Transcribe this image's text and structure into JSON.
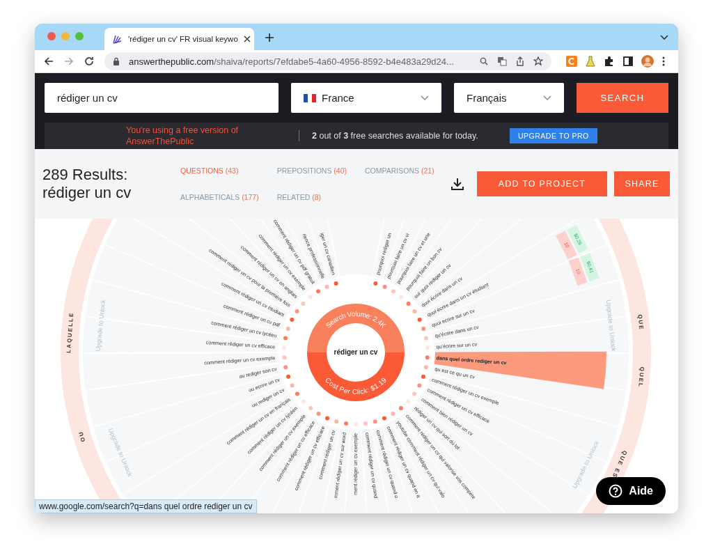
{
  "browser": {
    "tab_title": "'rédiger un cv' FR visual keywo",
    "url_domain": "answerthepublic.com",
    "url_path": "/shaiva/reports/7efdabe5-4a60-4956-8592-b4e483a29d24..."
  },
  "search": {
    "query": "rédiger un cv",
    "country": "France",
    "language": "Français",
    "button": "SEARCH"
  },
  "notice": {
    "message": "You're using a free version of AnswerThePublic",
    "quota": "**2** out of **3** free searches available for today.",
    "upgrade": "UPGRADE TO PRO"
  },
  "results": {
    "count": "289 Results:",
    "term": "rédiger un cv",
    "tabs": [
      {
        "label": "QUESTIONS",
        "count": "(43)",
        "selected": true
      },
      {
        "label": "PREPOSITIONS",
        "count": "(40)",
        "selected": false
      },
      {
        "label": "COMPARISONS",
        "count": "(21)",
        "selected": false
      },
      {
        "label": "ALPHABETICALS",
        "count": "(177)",
        "selected": false
      },
      {
        "label": "RELATED",
        "count": "(8)",
        "selected": false
      }
    ],
    "actions": [
      "ADD TO PROJECT",
      "SHARE"
    ]
  },
  "wheel": {
    "center": "rédiger un cv",
    "search_volume": "Search Volume: 2.4K",
    "cost_per_click": "Cost Per Click: $1.19",
    "groups": [
      "QUE",
      "QUEL",
      "QUE ES",
      "OU",
      "LAQUELLE"
    ],
    "upgrade_notes": [
      "Upgrade to Unlock",
      "Upgrade to Unlock",
      "Upgrade to Unlock",
      "Upgrade to Unlock"
    ],
    "metrics": [
      {
        "volume": "10",
        "cpc": "$0.26"
      },
      {
        "volume": "10",
        "cpc": "$0.41"
      }
    ],
    "keywords": [
      {
        "text": "pourquoi rediger un",
        "selected": false
      },
      {
        "text": "pourquoi faire un cv vi",
        "selected": false
      },
      {
        "text": "pourquoi faire un cv et une",
        "selected": false
      },
      {
        "text": "pourquoi faire un bon cv",
        "selected": false
      },
      {
        "text": "sur quoi rediger un cv",
        "selected": false
      },
      {
        "text": "quoi écrire dans un cv",
        "selected": false
      },
      {
        "text": "quoi écrire dans un cv étudiant",
        "selected": false
      },
      {
        "text": "quoi ecrire sur un cv",
        "selected": false
      },
      {
        "text": "qu'écrire dans un cv",
        "selected": false
      },
      {
        "text": "qu'écrire sur un cv",
        "selected": false
      },
      {
        "text": "dans quel ordre rediger un cv",
        "selected": true
      },
      {
        "text": "qu est ce qu un cv",
        "selected": false
      },
      {
        "text": "comment rédiger un cv exemple",
        "selected": false
      },
      {
        "text": "comment rédiger un cv efficace",
        "selected": false
      },
      {
        "text": "comment bien rédiger un cv",
        "selected": false
      },
      {
        "text": "rédiger un cv qui sort du lot",
        "selected": false
      },
      {
        "text": "comment rédiger un cv qui valorise vos compéte",
        "selected": false
      },
      {
        "text": "youtube comment rédiger un cv qui valo",
        "selected": false
      },
      {
        "text": "comment rédiger un cv quand on a",
        "selected": false
      },
      {
        "text": "comment rédiger un cv quand o",
        "selected": false
      },
      {
        "text": "comment rédiger un cv quand",
        "selected": false
      },
      {
        "text": "ment rédiger un cv exemple",
        "selected": false
      },
      {
        "text": "mment rédiger un cv sur word",
        "selected": false
      },
      {
        "text": "comment rédiger un cv",
        "selected": false
      },
      {
        "text": "comment rédiger un cv efficace",
        "selected": false
      },
      {
        "text": "comment rédiger un cv efficace",
        "selected": false
      },
      {
        "text": "comment rédiger un cv exemple",
        "selected": false
      },
      {
        "text": "comment rédiger un cv lycéen",
        "selected": false
      },
      {
        "text": "comment rédiger un cv en français",
        "selected": false
      },
      {
        "text": "ou rediger un cv",
        "selected": false
      },
      {
        "text": "ou ecrire un cv",
        "selected": false
      },
      {
        "text": "ou rediger son cv",
        "selected": false
      },
      {
        "text": "comment rédiger un cv exemple",
        "selected": false
      },
      {
        "text": "comment rédiger un cv efficace",
        "selected": false
      },
      {
        "text": "comment rédiger un cv lycéen",
        "selected": false
      },
      {
        "text": "comment rédiger un cv pdf",
        "selected": false
      },
      {
        "text": "comment rédiger un cv étudiant",
        "selected": false
      },
      {
        "text": "comment rédiger un cv pour la première fois",
        "selected": false
      },
      {
        "text": "comment rédiger un cv en anglais",
        "selected": false
      },
      {
        "text": "comment rédiger un cv exemple",
        "selected": false
      },
      {
        "text": "comment rédiger un cv pdf gratuit",
        "selected": false
      },
      {
        "text": "rience professionnelle",
        "selected": false
      },
      {
        "text": "iger un cv canadien",
        "selected": false
      }
    ]
  },
  "status_url": "www.google.com/search?q=dans quel ordre rediger un cv",
  "help": "Aide"
}
